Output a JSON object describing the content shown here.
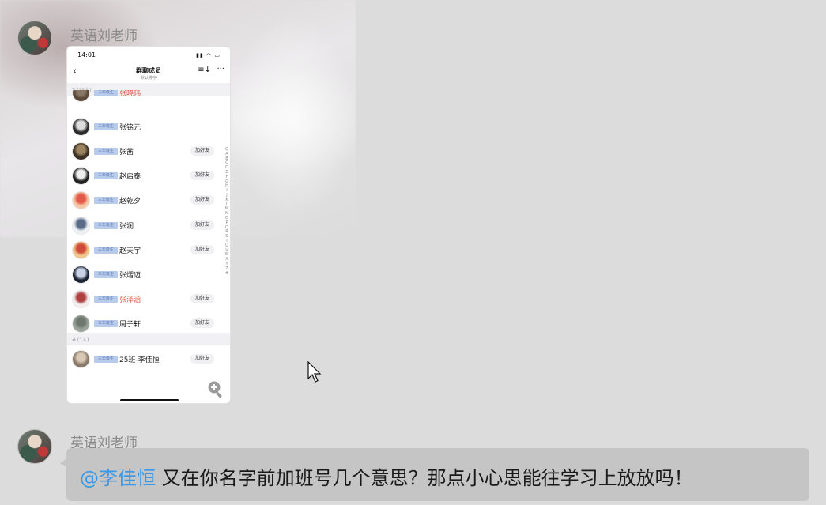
{
  "messages": [
    {
      "sender": "英语刘老师",
      "type": "image",
      "screenshot": {
        "status_time": "14:01",
        "status_icons": "▮▮ ◠ ▭",
        "nav_back": "‹",
        "nav_title": "群聊成员",
        "nav_subtitle": "默认排序",
        "nav_sort_icon": "≡↓",
        "nav_more_icon": "···",
        "sections": [
          {
            "header": "Z (13人)",
            "members": [
              {
                "badge": "三年级生",
                "name": "张晓玮",
                "name_color": "red",
                "add": "",
                "avatar_colors": [
                  "#5b4a3a",
                  "#8a7866"
                ]
              },
              {
                "badge": "三年级生",
                "name": "张铭元",
                "name_color": "normal",
                "add": "",
                "avatar_colors": [
                  "#2a2a2a",
                  "#dddddd"
                ]
              },
              {
                "badge": "三年级生",
                "name": "张茜",
                "name_color": "normal",
                "add": "加好友",
                "avatar_colors": [
                  "#3a2f22",
                  "#9c8460"
                ]
              },
              {
                "badge": "三年级生",
                "name": "赵启泰",
                "name_color": "normal",
                "add": "加好友",
                "avatar_colors": [
                  "#222222",
                  "#eeeeee"
                ]
              },
              {
                "badge": "三年级生",
                "name": "赵乾夕",
                "name_color": "normal",
                "add": "加好友",
                "avatar_colors": [
                  "#f5c9a8",
                  "#e45a4a"
                ]
              },
              {
                "badge": "三年级生",
                "name": "张润",
                "name_color": "normal",
                "add": "加好友",
                "avatar_colors": [
                  "#eef1f6",
                  "#5a6b88"
                ]
              },
              {
                "badge": "三年级生",
                "name": "赵天宇",
                "name_color": "normal",
                "add": "加好友",
                "avatar_colors": [
                  "#f1c68a",
                  "#d04a3a"
                ]
              },
              {
                "badge": "三年级生",
                "name": "张熠迈",
                "name_color": "normal",
                "add": "",
                "avatar_colors": [
                  "#1c2433",
                  "#c9d3e6"
                ]
              },
              {
                "badge": "三年级生",
                "name": "张泽涵",
                "name_color": "red",
                "add": "加好友",
                "avatar_colors": [
                  "#f3eeee",
                  "#b04040"
                ]
              },
              {
                "badge": "三年级生",
                "name": "周子轩",
                "name_color": "normal",
                "add": "加好友",
                "avatar_colors": [
                  "#9aa39a",
                  "#6d776d"
                ]
              }
            ]
          },
          {
            "header": "# (1人)",
            "members": [
              {
                "badge": "三年级生",
                "name": "25班-李佳恒",
                "name_color": "normal",
                "add": "加好友",
                "avatar_colors": [
                  "#8a7a6a",
                  "#d8c8b4"
                ]
              }
            ]
          }
        ],
        "index_letters": [
          "Q",
          "A",
          "B",
          "C",
          "D",
          "E",
          "F",
          "G",
          "H",
          "I",
          "J",
          "K",
          "L",
          "M",
          "N",
          "O",
          "P",
          "Q",
          "R",
          "S",
          "T",
          "U",
          "V",
          "W",
          "X",
          "Y",
          "Z",
          "#"
        ],
        "zoom_icon": "zoom-in-icon"
      }
    },
    {
      "sender": "英语刘老师",
      "type": "text",
      "mention": "@李佳恒",
      "text": " 又在你名字前加班号几个意思？那点小心思能往学习上放放吗！"
    }
  ],
  "colors": {
    "mention": "#3b9ae8",
    "bubble": "#c5c5c5",
    "badge_bg": "#b8cbea",
    "red_name": "#e2533f"
  }
}
